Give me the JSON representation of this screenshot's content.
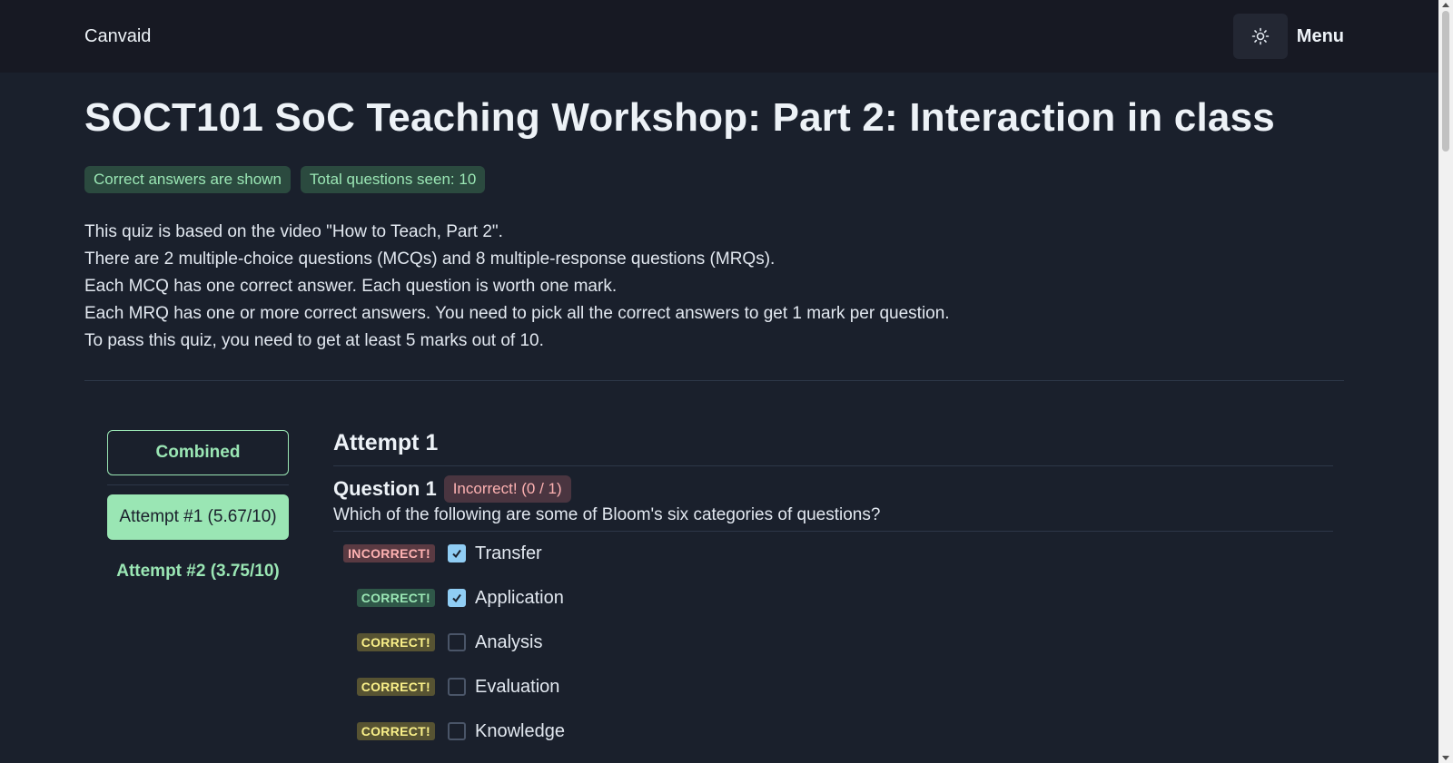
{
  "navbar": {
    "brand": "Canvaid",
    "theme_icon": "sun-icon",
    "menu_label": "Menu"
  },
  "page": {
    "title": "SOCT101 SoC Teaching Workshop: Part 2: Interaction in class",
    "tags": [
      "Correct answers are shown",
      "Total questions seen: 10"
    ],
    "description": [
      "This quiz is based on the video \"How to Teach, Part 2\".",
      "There are 2 multiple-choice questions (MCQs) and 8 multiple-response questions (MRQs).",
      "Each MCQ has one correct answer. Each question is worth one mark.",
      "Each MRQ has one or more correct answers. You need to pick all the correct answers to get 1 mark per question.",
      "To pass this quiz, you need to get at least 5 marks out of 10."
    ]
  },
  "sidebar": {
    "combined_label": "Combined",
    "attempts": [
      "Attempt #1 (5.67/10)",
      "Attempt #2 (3.75/10)"
    ],
    "active_attempt": "Attempt #1 (5.67/10)"
  },
  "attempt": {
    "title": "Attempt 1",
    "question": {
      "title": "Question 1",
      "status": "Incorrect! (0 / 1)",
      "text": "Which of the following are some of Bloom's six categories of questions?",
      "options": [
        {
          "badge": "INCORRECT!",
          "badge_color": "#5a3a42",
          "checked": true,
          "label": "Transfer"
        },
        {
          "badge": "CORRECT!",
          "badge_color": "#2f5748",
          "checked": true,
          "label": "Application"
        },
        {
          "badge": "CORRECT!",
          "badge_color": "#575332",
          "checked": false,
          "label": "Analysis"
        },
        {
          "badge": "CORRECT!",
          "badge_color": "#575332",
          "checked": false,
          "label": "Evaluation"
        },
        {
          "badge": "CORRECT!",
          "badge_color": "#575332",
          "checked": false,
          "label": "Knowledge"
        }
      ]
    }
  },
  "colors": {
    "accent": "#9ae6b4",
    "background": "#1a202c",
    "navbar": "#171923",
    "checkbox_checked": "#90cdf4"
  }
}
